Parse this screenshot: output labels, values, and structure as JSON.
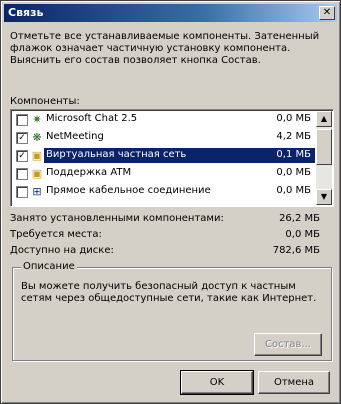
{
  "window": {
    "title": "Связь",
    "close_glyph": "✕"
  },
  "description": "Отметьте все устанавливаемые компоненты. Затененный флажок означает частичную установку компонента. Выяснить его состав позволяет кнопка Состав.",
  "components_label": "Компоненты:",
  "components": [
    {
      "checked": false,
      "icon": "msn-chat-icon",
      "glyph": "✷",
      "name": "Microsoft Chat 2.5",
      "size": "0,0 МБ",
      "selected": false
    },
    {
      "checked": true,
      "icon": "netmeeting-icon",
      "glyph": "❋",
      "name": "NetMeeting",
      "size": "4,2 МБ",
      "selected": false
    },
    {
      "checked": true,
      "icon": "vpn-icon",
      "glyph": "▣",
      "name": "Виртуальная частная сеть",
      "size": "0,1 МБ",
      "selected": true
    },
    {
      "checked": false,
      "icon": "atm-icon",
      "glyph": "▣",
      "name": "Поддержка ATM",
      "size": "0,0 МБ",
      "selected": false
    },
    {
      "checked": false,
      "icon": "direct-cable-icon",
      "glyph": "⊞",
      "name": "Прямое кабельное соединение",
      "size": "0,0 МБ",
      "selected": false
    }
  ],
  "stats": {
    "installed_label": "Занято установленными компонентами:",
    "installed_value": "26,2 МБ",
    "required_label": "Требуется места:",
    "required_value": "0,0 МБ",
    "available_label": "Доступно на диске:",
    "available_value": "782,6 МБ"
  },
  "description_group": {
    "title": "Описание",
    "text": "Вы можете получить безопасный доступ к частным сетям через общедоступные сети, такие как Интернет."
  },
  "buttons": {
    "details": "Состав...",
    "ok": "OK",
    "cancel": "Отмена"
  },
  "scrollbar": {
    "up_glyph": "▲",
    "down_glyph": "▼"
  },
  "check_glyph": "✓"
}
